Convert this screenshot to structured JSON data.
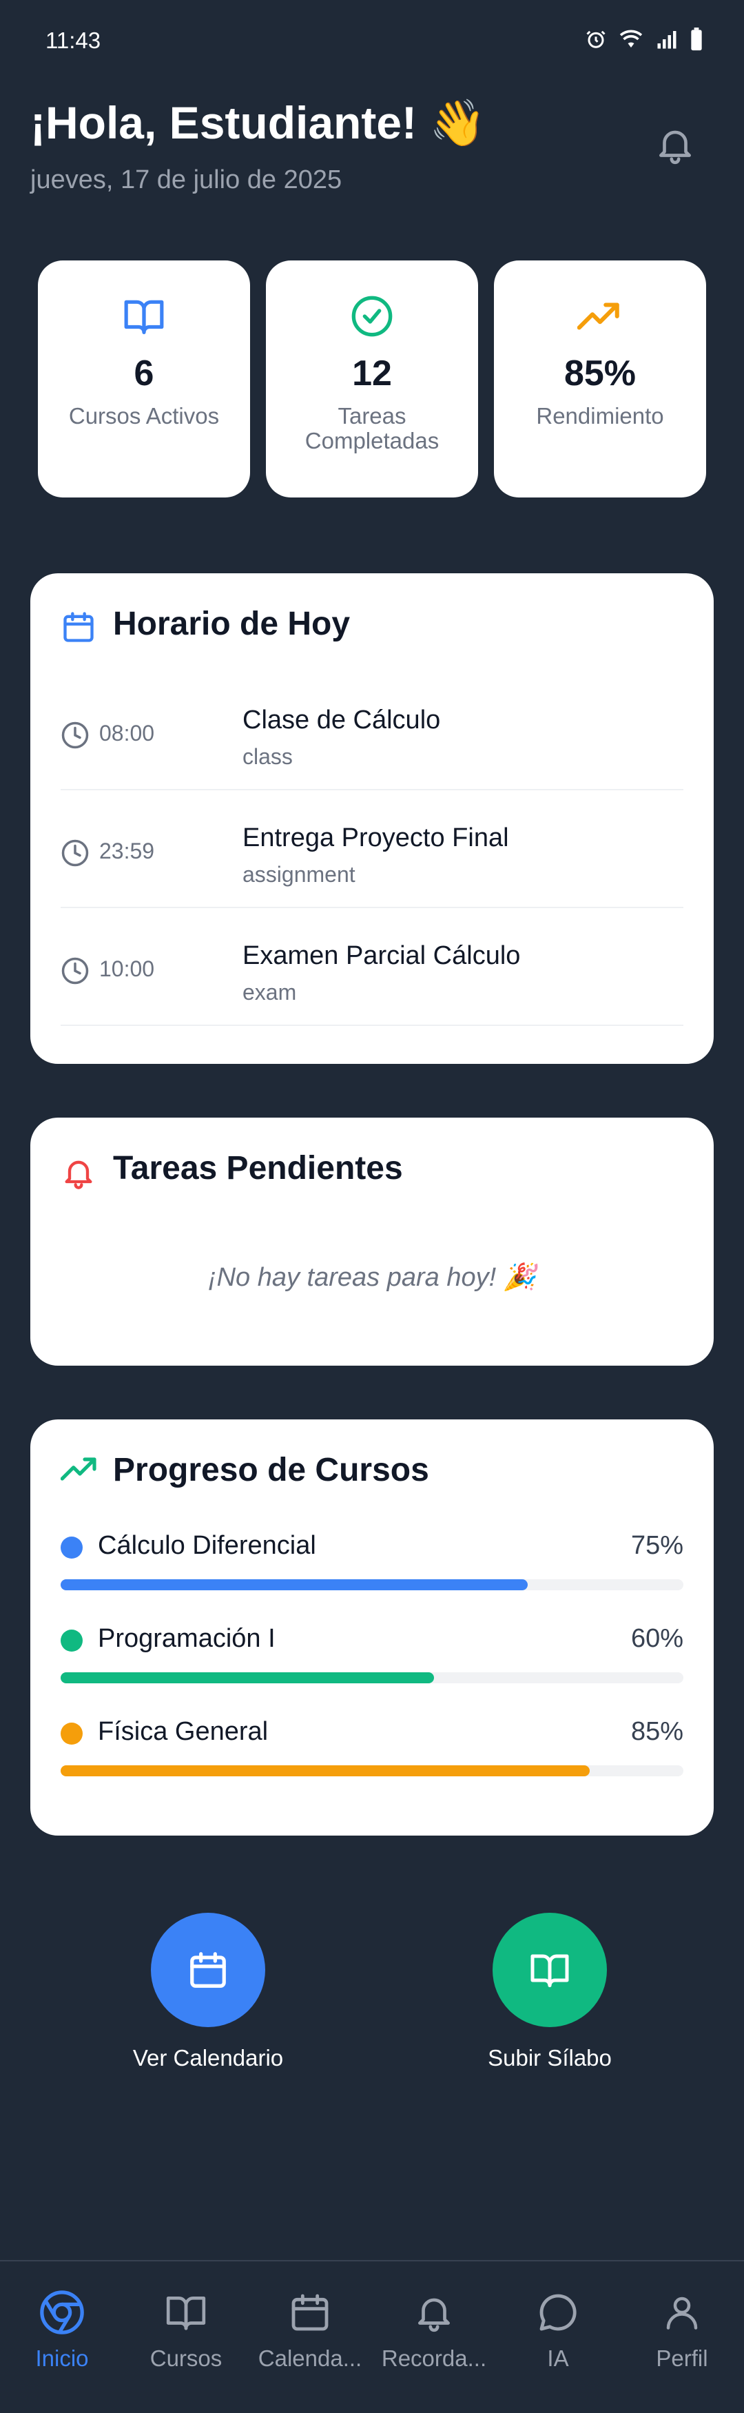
{
  "status_bar": {
    "time": "11:43"
  },
  "header": {
    "greeting": "¡Hola, Estudiante! 👋",
    "date": "jueves, 17 de julio de 2025"
  },
  "stats": [
    {
      "icon": "book-open-icon",
      "value": "6",
      "label": "Cursos Activos",
      "color": "#3b82f6"
    },
    {
      "icon": "check-circle-icon",
      "value": "12",
      "label": "Tareas Completadas",
      "color": "#10b981"
    },
    {
      "icon": "trending-up-icon",
      "value": "85%",
      "label": "Rendimiento",
      "color": "#f59e0b"
    }
  ],
  "schedule": {
    "title": "Horario de Hoy",
    "items": [
      {
        "time": "08:00",
        "title": "Clase de Cálculo",
        "type": "class"
      },
      {
        "time": "23:59",
        "title": "Entrega Proyecto Final",
        "type": "assignment"
      },
      {
        "time": "10:00",
        "title": "Examen Parcial Cálculo",
        "type": "exam"
      }
    ]
  },
  "pending": {
    "title": "Tareas Pendientes",
    "empty_message": "¡No hay tareas para hoy! 🎉"
  },
  "progress": {
    "title": "Progreso de Cursos",
    "courses": [
      {
        "name": "Cálculo Diferencial",
        "percent_label": "75%",
        "percent": 75,
        "color": "#3b82f6"
      },
      {
        "name": "Programación I",
        "percent_label": "60%",
        "percent": 60,
        "color": "#10b981"
      },
      {
        "name": "Física General",
        "percent_label": "85%",
        "percent": 85,
        "color": "#f59e0b"
      }
    ]
  },
  "actions": [
    {
      "label": "Ver Calendario",
      "color": "#3b82f6",
      "icon": "calendar-icon"
    },
    {
      "label": "Subir Sílabo",
      "color": "#10b981",
      "icon": "book-open-icon"
    }
  ],
  "nav": [
    {
      "label": "Inicio",
      "icon": "chrome-icon",
      "active": true
    },
    {
      "label": "Cursos",
      "icon": "book-icon"
    },
    {
      "label": "Calenda...",
      "icon": "calendar-icon"
    },
    {
      "label": "Recorda...",
      "icon": "bell-icon"
    },
    {
      "label": "IA",
      "icon": "chat-icon"
    },
    {
      "label": "Perfil",
      "icon": "user-icon"
    }
  ],
  "colors": {
    "background": "#1f2937",
    "card": "#ffffff",
    "accent": "#3b82f6"
  }
}
